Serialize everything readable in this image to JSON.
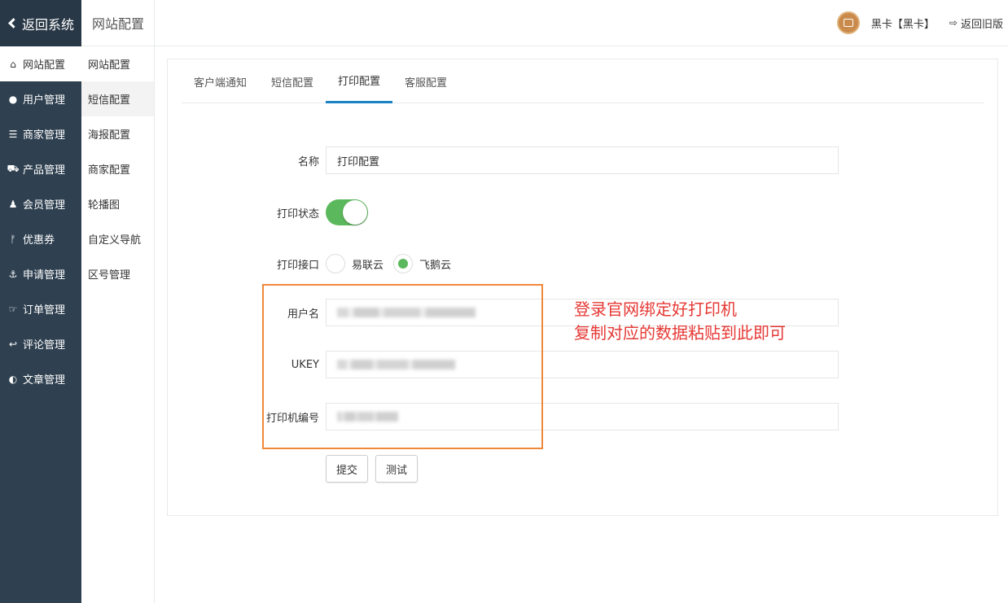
{
  "sidebar": {
    "back_label": "返回系统",
    "items": [
      {
        "icon": "home-icon",
        "glyph": "⌂",
        "label": "网站配置"
      },
      {
        "icon": "user-icon",
        "glyph": "●",
        "label": "用户管理"
      },
      {
        "icon": "server-icon",
        "glyph": "☰",
        "label": "商家管理"
      },
      {
        "icon": "cart-icon",
        "glyph": "⛟",
        "label": "产品管理"
      },
      {
        "icon": "member-icon",
        "glyph": "♟",
        "label": "会员管理"
      },
      {
        "icon": "branch-icon",
        "glyph": "ᚠ",
        "label": "优惠券"
      },
      {
        "icon": "anchor-icon",
        "glyph": "⚓",
        "label": "申请管理"
      },
      {
        "icon": "hand-icon",
        "glyph": "☞",
        "label": "订单管理"
      },
      {
        "icon": "reply-icon",
        "glyph": "↩",
        "label": "评论管理"
      },
      {
        "icon": "adjust-icon",
        "glyph": "◐",
        "label": "文章管理"
      }
    ]
  },
  "subnav": {
    "title": "网站配置",
    "items": [
      "网站配置",
      "短信配置",
      "海报配置",
      "商家配置",
      "轮播图",
      "自定义导航",
      "区号管理"
    ]
  },
  "header": {
    "user_name": "黑卡【黑卡】",
    "old_version": "返回旧版"
  },
  "tabs": [
    "客户端通知",
    "短信配置",
    "打印配置",
    "客服配置"
  ],
  "form": {
    "name_label": "名称",
    "name_value": "打印配置",
    "status_label": "打印状态",
    "status_on": true,
    "interface_label": "打印接口",
    "interface_options": [
      "易联云",
      "飞鹅云"
    ],
    "interface_selected": "飞鹅云",
    "username_label": "用户名",
    "ukey_label": "UKEY",
    "printer_no_label": "打印机编号",
    "submit_label": "提交",
    "test_label": "测试"
  },
  "annotation": {
    "line1": "登录官网绑定好打印机",
    "line2": "复制对应的数据粘贴到此即可",
    "box_color": "#f0883a",
    "text_color": "#e53935"
  },
  "colors": {
    "sidebar_bg": "#2f4050",
    "tab_active": "#1c84c6",
    "toggle_on": "#5cb85c"
  }
}
